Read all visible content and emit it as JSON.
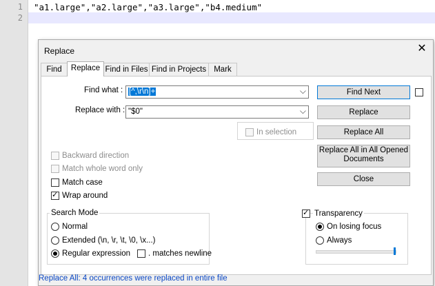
{
  "editor": {
    "lines": [
      {
        "number": "1",
        "text": "\"a1.large\",\"a2.large\",\"a3.large\",\"b4.medium\""
      },
      {
        "number": "2",
        "text": ""
      }
    ]
  },
  "dialog": {
    "title": "Replace",
    "tabs": [
      "Find",
      "Replace",
      "Find in Files",
      "Find in Projects",
      "Mark"
    ],
    "active_tab": "Replace",
    "find_what_label": "Find what :",
    "find_what_value": "[^,\\r\\n]+",
    "replace_with_label": "Replace with :",
    "replace_with_value": "\"$0\"",
    "in_selection_label": "In selection",
    "buttons": {
      "find_next": "Find Next",
      "replace": "Replace",
      "replace_all": "Replace All",
      "replace_all_opened": "Replace All in All Opened Documents",
      "close": "Close"
    },
    "options": {
      "backward_direction": {
        "label": "Backward direction",
        "checked": false,
        "enabled": false
      },
      "match_whole_word": {
        "label": "Match whole word only",
        "checked": false,
        "enabled": false
      },
      "match_case": {
        "label": "Match case",
        "checked": false,
        "enabled": true
      },
      "wrap_around": {
        "label": "Wrap around",
        "checked": true,
        "enabled": true
      }
    },
    "search_mode": {
      "label": "Search Mode",
      "normal": "Normal",
      "extended": "Extended (\\n, \\r, \\t, \\0, \\x...)",
      "regex": "Regular expression",
      "selected": "regex",
      "matches_newline": ". matches newline"
    },
    "transparency": {
      "label": "Transparency",
      "checked": true,
      "on_losing_focus": "On losing focus",
      "always": "Always",
      "selected": "on_losing_focus",
      "level": 1.0
    },
    "status": "Replace All: 4 occurrences were replaced in entire file"
  },
  "colors": {
    "accent": "#0078d7",
    "status_text": "#0a47c4",
    "current_line": "#e8e8ff"
  }
}
